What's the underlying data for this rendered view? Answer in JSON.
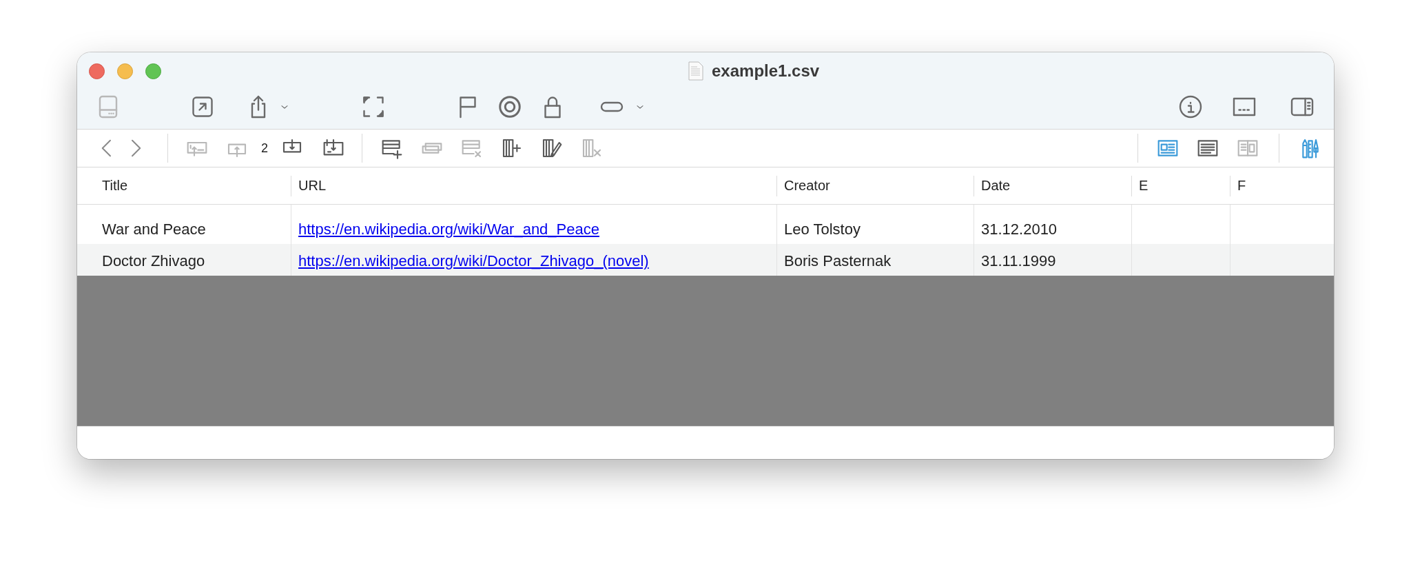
{
  "window": {
    "title": "example1.csv"
  },
  "toolbar": {
    "items": [
      {
        "disabled": true
      },
      {
        "disabled": false
      },
      {
        "disabled": false
      },
      {
        "disabled": false
      },
      {
        "disabled": false
      },
      {
        "disabled": false
      },
      {
        "disabled": false
      },
      {
        "disabled": false
      },
      {
        "disabled": false
      },
      {
        "disabled": false
      },
      {
        "disabled": false
      },
      {
        "disabled": false
      },
      {
        "disabled": false
      }
    ]
  },
  "action_bar": {
    "row_tools": [
      {
        "disabled": true
      },
      {
        "disabled": true
      },
      {
        "disabled": false
      },
      {
        "disabled": false
      }
    ],
    "page_number": "2",
    "column_tools": [
      {
        "disabled": false
      },
      {
        "disabled": true
      },
      {
        "disabled": true
      },
      {
        "disabled": false
      },
      {
        "disabled": false
      },
      {
        "disabled": true
      }
    ],
    "views": [
      {
        "selected": true,
        "disabled": false
      },
      {
        "selected": false,
        "disabled": false
      },
      {
        "selected": false,
        "disabled": true
      }
    ],
    "inspector": {
      "on": true
    }
  },
  "table": {
    "columns": [
      "Title",
      "URL",
      "Creator",
      "Date",
      "E",
      "F"
    ],
    "rows": [
      {
        "cells": [
          {
            "kind": "text",
            "text": "War and Peace"
          },
          {
            "kind": "link",
            "text": "https://en.wikipedia.org/wiki/War_and_Peace"
          },
          {
            "kind": "text",
            "text": "Leo Tolstoy"
          },
          {
            "kind": "text",
            "text": "31.12.2010"
          }
        ]
      },
      {
        "cells": [
          {
            "kind": "text",
            "text": "Doctor Zhivago"
          },
          {
            "kind": "link",
            "text": "https://en.wikipedia.org/wiki/Doctor_Zhivago_(novel)"
          },
          {
            "kind": "text",
            "text": "Boris Pasternak"
          },
          {
            "kind": "text",
            "text": "31.11.1999"
          }
        ]
      }
    ]
  }
}
